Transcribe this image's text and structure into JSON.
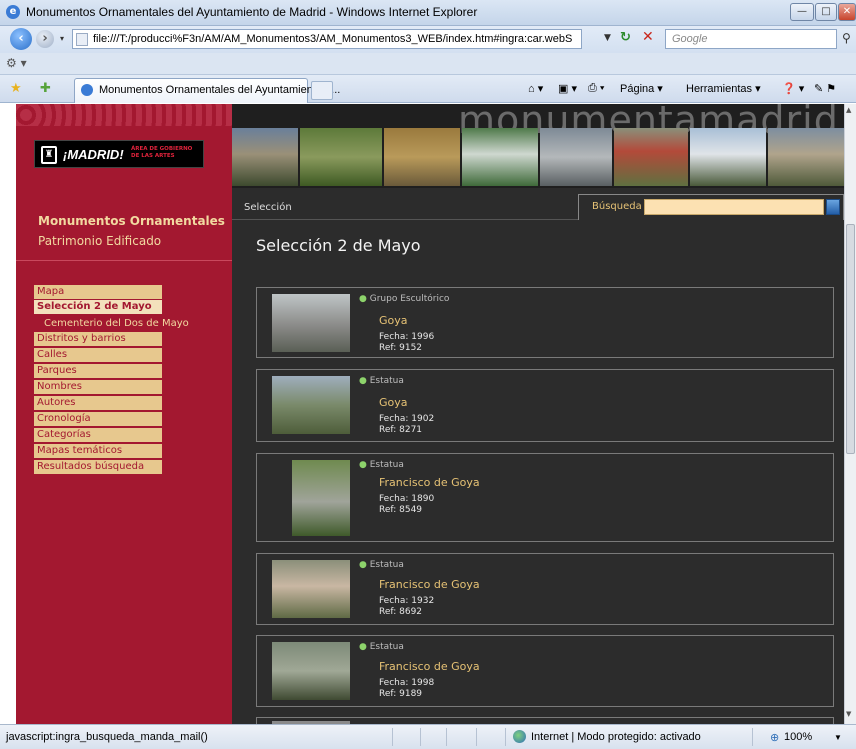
{
  "window": {
    "title": "Monumentos Ornamentales del Ayuntamiento de Madrid - Windows Internet Explorer",
    "controls": [
      "—",
      "□",
      "✕"
    ]
  },
  "address": {
    "url": "file:///T:/producci%F3n/AM/AM_Monumentos3/AM_Monumentos3_WEB/index.htm#ingra:car.webS",
    "search_placeholder": "Google"
  },
  "tab": {
    "label": "Monumentos Ornamentales del Ayuntamiento d..."
  },
  "toolbar": {
    "pagina": "Página ▾",
    "herramientas": "Herramientas ▾"
  },
  "sidebar": {
    "logo_text": "¡MADRID!",
    "logo_area": "ÁREA DE GOBIERNO DE LAS ARTES",
    "title": "Monumentos Ornamentales",
    "subtitle": "Patrimonio Edificado",
    "menu": [
      {
        "label": "Mapa",
        "active": false
      },
      {
        "label": "Selección 2 de Mayo",
        "active": true
      },
      {
        "label": "Distritos y barrios",
        "active": false
      },
      {
        "label": "Calles",
        "active": false
      },
      {
        "label": "Parques",
        "active": false
      },
      {
        "label": "Nombres",
        "active": false
      },
      {
        "label": "Autores",
        "active": false
      },
      {
        "label": "Cronología",
        "active": false
      },
      {
        "label": "Categorías",
        "active": false
      },
      {
        "label": "Mapas temáticos",
        "active": false
      },
      {
        "label": "Resultados búsqueda",
        "active": false
      }
    ],
    "submenu_item": "Cementerio del Dos de Mayo"
  },
  "header": {
    "banner_text": "monumentamadrid"
  },
  "tabs": {
    "seleccion": "Selección",
    "busqueda": "Búsqueda"
  },
  "main": {
    "title": "Selección 2 de Mayo",
    "cards": [
      {
        "type": "Grupo Escultórico",
        "name": "Goya",
        "fecha": "Fecha: 1996",
        "ref": "Ref: 9152"
      },
      {
        "type": "Estatua",
        "name": "Goya",
        "fecha": "Fecha: 1902",
        "ref": "Ref: 8271"
      },
      {
        "type": "Estatua",
        "name": "Francisco de Goya",
        "fecha": "Fecha: 1890",
        "ref": "Ref: 8549"
      },
      {
        "type": "Estatua",
        "name": "Francisco de Goya",
        "fecha": "Fecha: 1932",
        "ref": "Ref: 8692"
      },
      {
        "type": "Estatua",
        "name": "Francisco de Goya",
        "fecha": "Fecha: 1998",
        "ref": "Ref: 9189"
      }
    ]
  },
  "status": {
    "left": "javascript:ingra_busqueda_manda_mail()",
    "zone": "Internet | Modo protegido: activado",
    "zoom": "100%"
  },
  "colors": {
    "sidebar_bg": "#a31830",
    "menu_bg": "#e7c88e",
    "page_bg": "#2c2c2c",
    "accent_gold": "#e6c275",
    "dot_green": "#8dd36b"
  }
}
